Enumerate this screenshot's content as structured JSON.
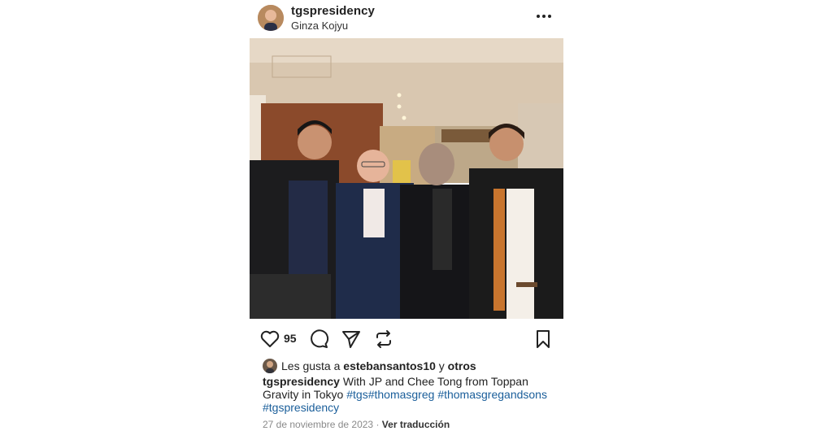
{
  "header": {
    "username": "tgspresidency",
    "location": "Ginza Kojyu",
    "avatar_icon": "profile-avatar",
    "more_icon": "more-options-icon"
  },
  "photo": {
    "icon": "post-photo"
  },
  "actions": {
    "like_icon": "heart-icon",
    "likes_count": "95",
    "comment_icon": "comment-icon",
    "share_icon": "send-icon",
    "repost_icon": "repost-icon",
    "save_icon": "bookmark-icon"
  },
  "liked_by": {
    "prefix": "Les gusta a",
    "user": "estebansantos10",
    "joiner": "y",
    "others": "otros"
  },
  "caption": {
    "username": "tgspresidency",
    "text": "With JP and Chee Tong from Toppan Gravity in Tokyo",
    "hashtags": [
      "#tgs",
      "#thomasgreg",
      "#thomasgregandsons",
      "#tgspresidency"
    ]
  },
  "meta": {
    "date": "27 de noviembre de 2023",
    "separator": "·",
    "translate": "Ver traducción"
  },
  "colors": {
    "hashtag": "#1a5e9a",
    "meta": "#8a8a8a"
  }
}
